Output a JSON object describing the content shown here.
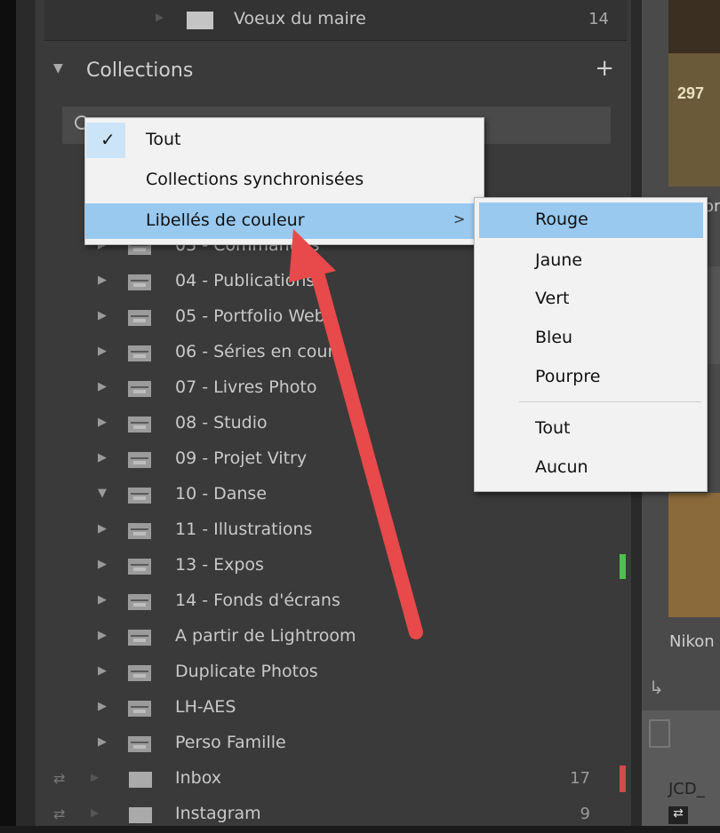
{
  "folder_item": {
    "label": "Voeux du maire",
    "count": "14"
  },
  "collections": {
    "title": "Collections",
    "add_symbol": "+",
    "items": [
      {
        "label": "03 - Commandes"
      },
      {
        "label": "04 - Publications"
      },
      {
        "label": "05 - Portfolio Web"
      },
      {
        "label": "06 - Séries en cours"
      },
      {
        "label": "07 - Livres Photo"
      },
      {
        "label": "08 - Studio"
      },
      {
        "label": "09 - Projet Vitry"
      },
      {
        "label": "10 - Danse",
        "expanded": true
      },
      {
        "label": "11 - Illustrations"
      },
      {
        "label": "13 - Expos",
        "color_label": "#4fbf4f"
      },
      {
        "label": "14 - Fonds d'écrans"
      },
      {
        "label": "A partir de Lightroom"
      },
      {
        "label": "Duplicate Photos"
      },
      {
        "label": "LH-AES"
      },
      {
        "label": "Perso Famille"
      }
    ],
    "sync_items": [
      {
        "label": "Inbox",
        "count": "17",
        "color_label": "#d34a4a"
      },
      {
        "label": "Instagram",
        "count": "9"
      }
    ]
  },
  "filter_menu": {
    "items": [
      {
        "label": "Tout",
        "checked": true
      },
      {
        "label": "Collections synchronisées"
      },
      {
        "label": "Libellés de couleur",
        "has_submenu": true,
        "highlighted": true
      }
    ],
    "submenu_arrow": ">",
    "check_mark": "✓"
  },
  "color_submenu": {
    "items": [
      "Rouge",
      "Jaune",
      "Vert",
      "Bleu",
      "Pourpre",
      "Tout",
      "Aucun"
    ],
    "highlighted_index": 0
  },
  "right_panel": {
    "thumb_number": "297",
    "partial_text_1": "or",
    "partial_text_2": "Nikon",
    "partial_text_3": "JCD_"
  },
  "colors": {
    "highlight": "#99c9ef",
    "arrow": "#e8494a"
  }
}
